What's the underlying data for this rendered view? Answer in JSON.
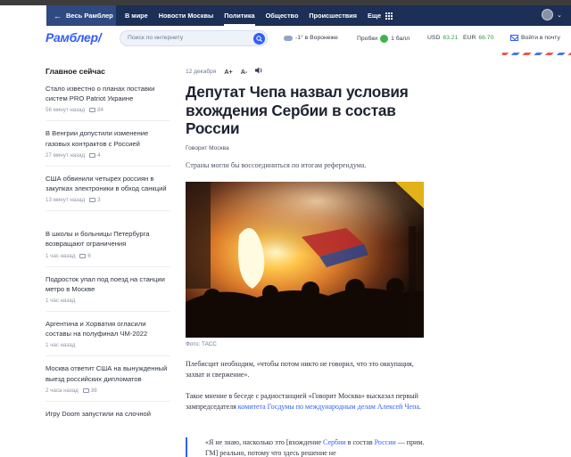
{
  "nav": {
    "all_label": "Весь Рамблер",
    "items": [
      {
        "label": "В мире",
        "active": false
      },
      {
        "label": "Новости Москвы",
        "active": false
      },
      {
        "label": "Политика",
        "active": true
      },
      {
        "label": "Общество",
        "active": false
      },
      {
        "label": "Происшествия",
        "active": false
      },
      {
        "label": "Еще",
        "active": false
      }
    ]
  },
  "header": {
    "logo": "Рамблер/",
    "search_placeholder": "Поиск по интернету",
    "weather": "-1° в Воронеже",
    "traffic_label": "Пробки",
    "traffic_value": "1 балл",
    "usd_label": "USD",
    "usd_value": "63.21",
    "eur_label": "EUR",
    "eur_value": "66.70",
    "mail_label": "Войти в почту"
  },
  "sidebar": {
    "title": "Главное сейчас",
    "news": [
      {
        "title": "Стало известно о планах поставки систем PRO Patriot Украине",
        "time": "56 минут назад",
        "comments": "84"
      },
      {
        "title": "В Венгрии допустили изменение газовых контрактов с Россией",
        "time": "27 минут назад",
        "comments": "4"
      },
      {
        "title": "США обвинили четырех россиян в закупках электроники в обход санкций",
        "time": "13 минут назад",
        "comments": "3"
      },
      {
        "title": "В школы и больницы Петербурга возвращают ограничения",
        "time": "1 час назад",
        "comments": "6"
      },
      {
        "title": "Подросток упал под поезд на станции метро в Москве",
        "time": "1 час назад",
        "comments": ""
      },
      {
        "title": "Аргентина и Хорватия огласили составы на полуфинал ЧМ-2022",
        "time": "1 час назад",
        "comments": ""
      },
      {
        "title": "Москва ответит США на вынужденный выезд российских дипломатов",
        "time": "2 часа назад",
        "comments": "38"
      },
      {
        "title": "Игру Doom запустили на слочной",
        "time": "",
        "comments": ""
      }
    ]
  },
  "article": {
    "date": "12 декабря",
    "font_up": "A+",
    "font_down": "A-",
    "title": "Депутат Чепа назвал условия вхождения Сербии в состав России",
    "source": "Говорит Москва",
    "lead": "Страны могли бы воссоединиться по итогам референдума.",
    "photo_credit": "Фото: ТАСС",
    "p1": "Плебисцит необходим, «чтобы потом никто не говорил, что это оккупация, захват и свержение».",
    "p2_start": "Такое мнение в беседе с радиостанцией «Говорит Москва» высказал первый зампредседателя ",
    "p2_link": "комитета Госдумы по международным делам Алексей Чепа",
    "p2_end": ".",
    "quote_start": "«Я не знаю, насколько это [вхождение ",
    "quote_link1": "Сербии",
    "quote_mid": " в состав ",
    "quote_link2": "России",
    "quote_end": " — прим. ГМ] реально, потому что здесь решение не"
  }
}
